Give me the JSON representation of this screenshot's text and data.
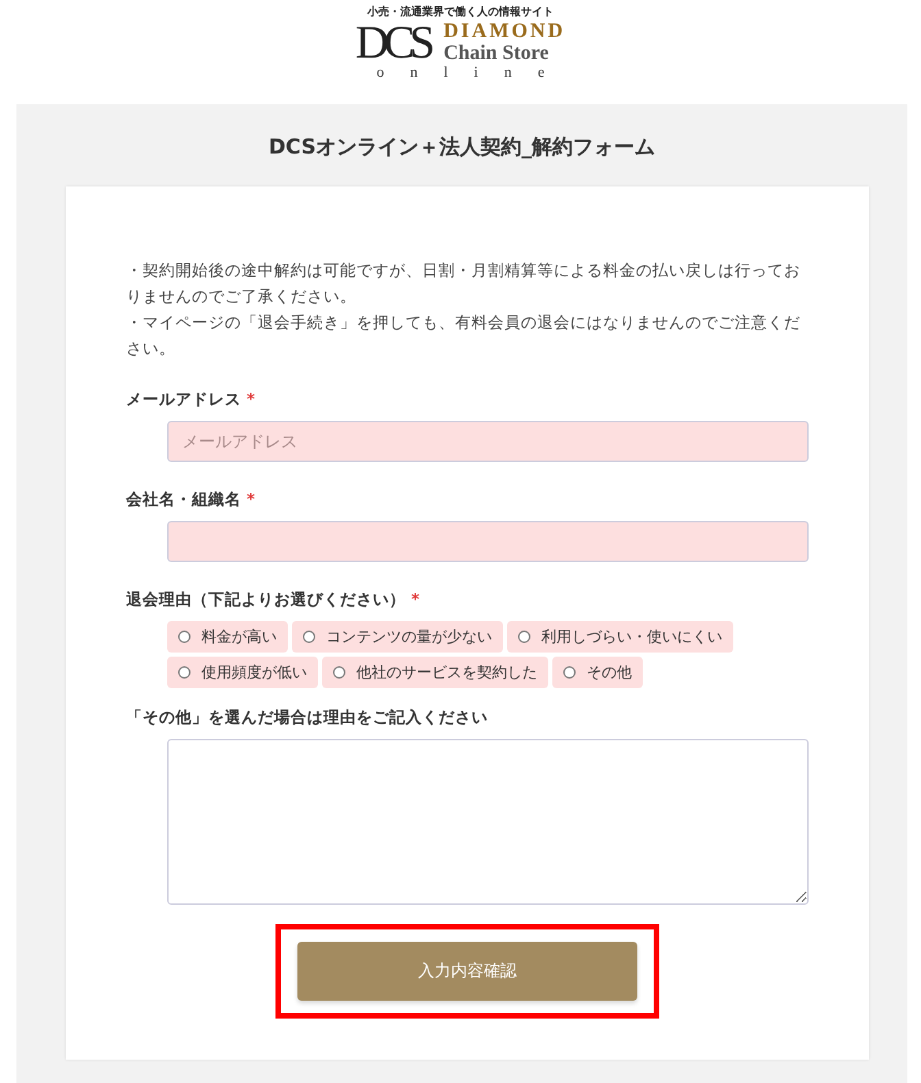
{
  "header": {
    "tagline": "小売・流通業界で働く人の情報サイト",
    "logo_mark": "DCS",
    "logo_line1": "DIAMOND",
    "logo_line2": "Chain Store",
    "logo_line3": "online"
  },
  "form": {
    "title": "DCSオンライン＋法人契約_解約フォーム",
    "notices": [
      "・契約開始後の途中解約は可能ですが、日割・月割精算等による料金の払い戻しは行っておりませんのでご了承ください。",
      "・マイページの「退会手続き」を押しても、有料会員の退会にはなりませんのでご注意ください。"
    ],
    "fields": [
      {
        "kind": "text",
        "label": "メールアドレス",
        "required_mark": "*",
        "placeholder": "メールアドレス",
        "invalid": true
      },
      {
        "kind": "text",
        "label": "会社名・組織名",
        "required_mark": "*",
        "invalid": true
      },
      {
        "kind": "radio",
        "label": "退会理由（下記よりお選びください）",
        "required_mark": "*",
        "invalid": true,
        "options": [
          {
            "label": "料金が高い",
            "selected": false
          },
          {
            "label": "コンテンツの量が少ない",
            "selected": false
          },
          {
            "label": "利用しづらい・使いにくい",
            "selected": false
          },
          {
            "label": "使用頻度が低い",
            "selected": false
          },
          {
            "label": "他社のサービスを契約した",
            "selected": false
          },
          {
            "label": "その他",
            "selected": false
          }
        ]
      },
      {
        "kind": "textarea",
        "label": "「その他」を選んだ場合は理由をご記入ください",
        "invalid": false
      }
    ],
    "submit": {
      "label": "入力内容確認",
      "highlighted": true
    }
  }
}
